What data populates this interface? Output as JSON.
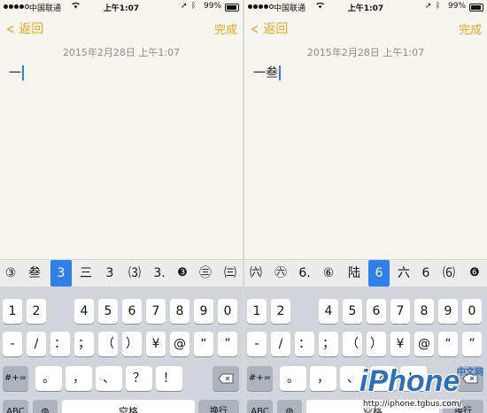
{
  "status": {
    "carrier": "中国联通",
    "time": "上午1:07",
    "battery": "99%"
  },
  "nav": {
    "back_label": "返回",
    "done_label": "完成"
  },
  "note": {
    "date": "2015年2月28日 上午1:07"
  },
  "left": {
    "text": "一",
    "candidates": [
      "③",
      "叁",
      "3",
      "三",
      "3",
      "⑶",
      "3.",
      "❸",
      "㊂",
      "㈢"
    ],
    "selected_index": 2
  },
  "right": {
    "text": "一叁",
    "candidates": [
      "㈥",
      "㊅",
      "6.",
      "⑥",
      "陆",
      "6",
      "六",
      "6",
      "⑹",
      "❻"
    ],
    "selected_index": 5
  },
  "keyboard": {
    "row1": [
      "1",
      "2",
      "",
      "4",
      "5",
      "6",
      "7",
      "8",
      "9",
      "0"
    ],
    "row2": [
      "-",
      "/",
      "：",
      "；",
      "（",
      "）",
      "¥",
      "@",
      "“",
      "”"
    ],
    "row3_mode": "#+=",
    "row3": [
      "。",
      "，",
      "、",
      "？",
      "！",
      "."
    ],
    "row4_abc": "ABC",
    "row4_space": "空格",
    "row4_return": "换行"
  },
  "watermark": {
    "brand": "iPhone",
    "cn": "中文网",
    "url": "http://iphone.tgbus.com/"
  },
  "colors": {
    "accent": "#e6a817",
    "selection": "#2f7fe8"
  },
  "icons": [
    "wifi-icon",
    "location-icon",
    "bluetooth-icon",
    "battery-icon",
    "chevron-left-icon",
    "delete-icon",
    "globe-icon"
  ]
}
